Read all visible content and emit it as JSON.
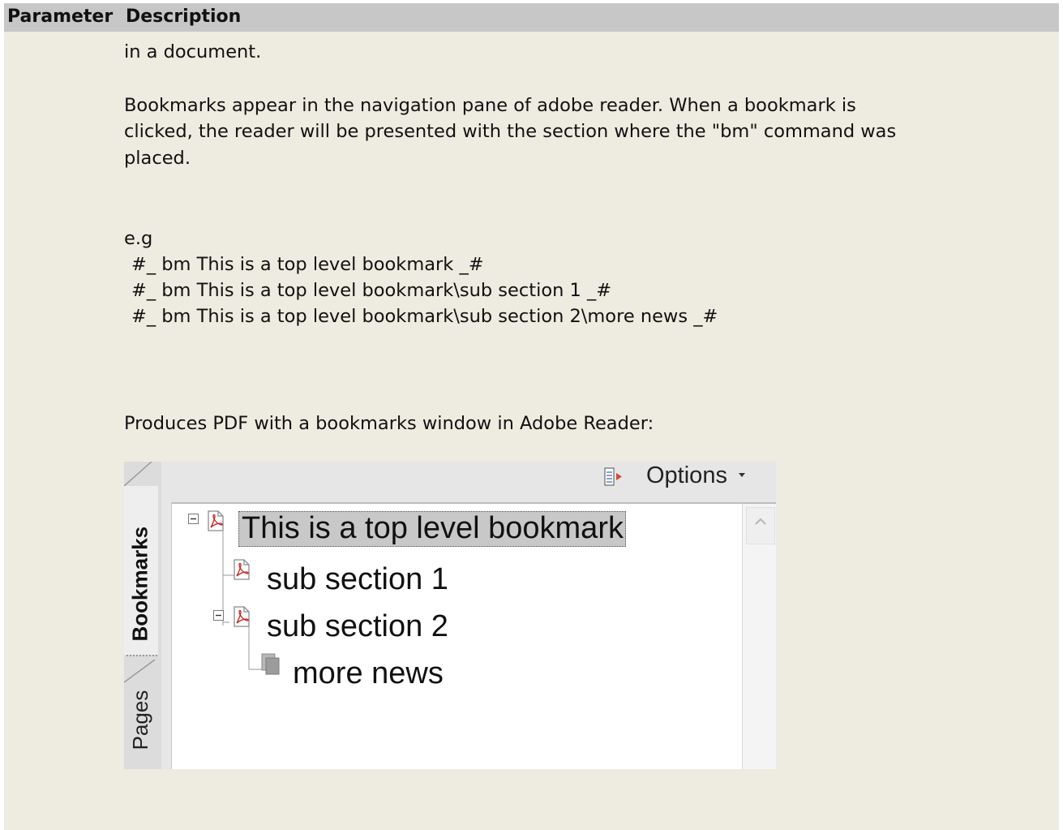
{
  "table": {
    "headers": {
      "parameter": "Parameter",
      "description": "Description"
    }
  },
  "description": {
    "intro_fragment": "in a document.",
    "paragraph_line_1": "Bookmarks appear in the navigation pane of adobe reader.   When a bookmark is",
    "paragraph_line_2": "clicked, the reader will be presented with the section where the \"bm\" command was",
    "paragraph_line_3": "placed.",
    "example_label": "e.g",
    "example_lines": [
      "#_ bm This is a top level bookmark _#",
      "#_ bm This is a top level bookmark\\sub section 1 _#",
      "#_ bm This is a top level bookmark\\sub section 2\\more news _#"
    ],
    "produces_text": "Produces PDF with a bookmarks window in Adobe Reader:"
  },
  "reader_panel": {
    "tabs": {
      "bookmarks": "Bookmarks",
      "pages": "Pages"
    },
    "toolbar": {
      "options_label": "Options",
      "close_label": "×",
      "options_icon": "bookmark-options-icon"
    },
    "bookmarks": [
      {
        "label": "This is a top level bookmark",
        "level": 0,
        "selected": true,
        "expanded": true,
        "icon": "pdf-page-icon"
      },
      {
        "label": "sub section 1",
        "level": 1,
        "selected": false,
        "icon": "pdf-page-icon"
      },
      {
        "label": "sub section 2",
        "level": 1,
        "selected": false,
        "expanded": true,
        "icon": "pdf-page-icon"
      },
      {
        "label": "more news",
        "level": 2,
        "selected": false,
        "icon": "gray-page-icon"
      }
    ]
  },
  "colors": {
    "page_background": "#eeebe0",
    "header_background": "#c7c7c7",
    "selected_bookmark": "#c8c8c8",
    "pdf_icon_red": "#c8201e"
  }
}
